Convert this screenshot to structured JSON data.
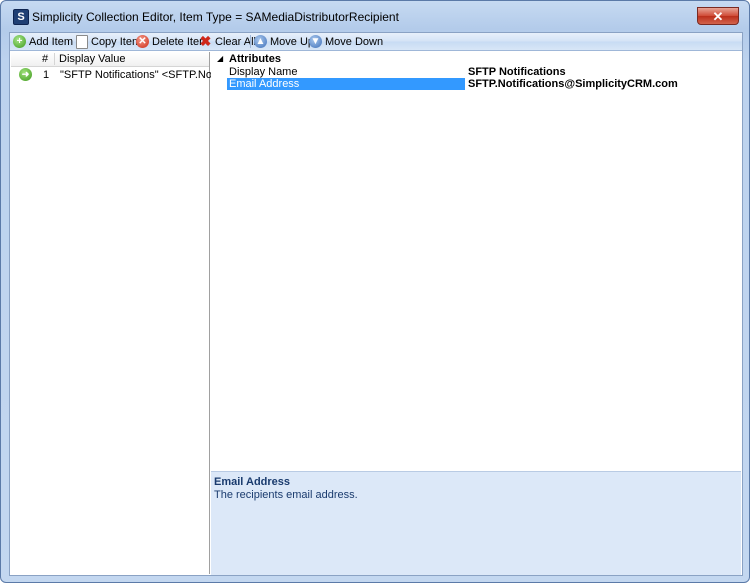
{
  "window": {
    "title": "Simplicity Collection Editor, Item Type = SAMediaDistributorRecipient",
    "app_icon_letter": "S",
    "close_glyph": "✕"
  },
  "toolbar": {
    "add_item": "Add Item",
    "copy_item": "Copy Item",
    "delete_item": "Delete Item",
    "clear_all": "Clear All",
    "move_up": "Move Up",
    "move_down": "Move Down"
  },
  "list": {
    "columns": {
      "index": "#",
      "display_value": "Display Value"
    },
    "rows": [
      {
        "index": "1",
        "display_value": "\"SFTP Notifications\" <SFTP.Notificati..."
      }
    ]
  },
  "properties": {
    "category": "Attributes",
    "items": [
      {
        "name": "Display Name",
        "value": "SFTP Notifications"
      },
      {
        "name": "Email Address",
        "value": "SFTP.Notifications@SimplicityCRM.com"
      }
    ]
  },
  "description": {
    "title": "Email Address",
    "text": "The recipients email address."
  },
  "colors": {
    "selection": "#3399ff",
    "description_bg": "#dce8f8",
    "close": "#c8412c"
  }
}
